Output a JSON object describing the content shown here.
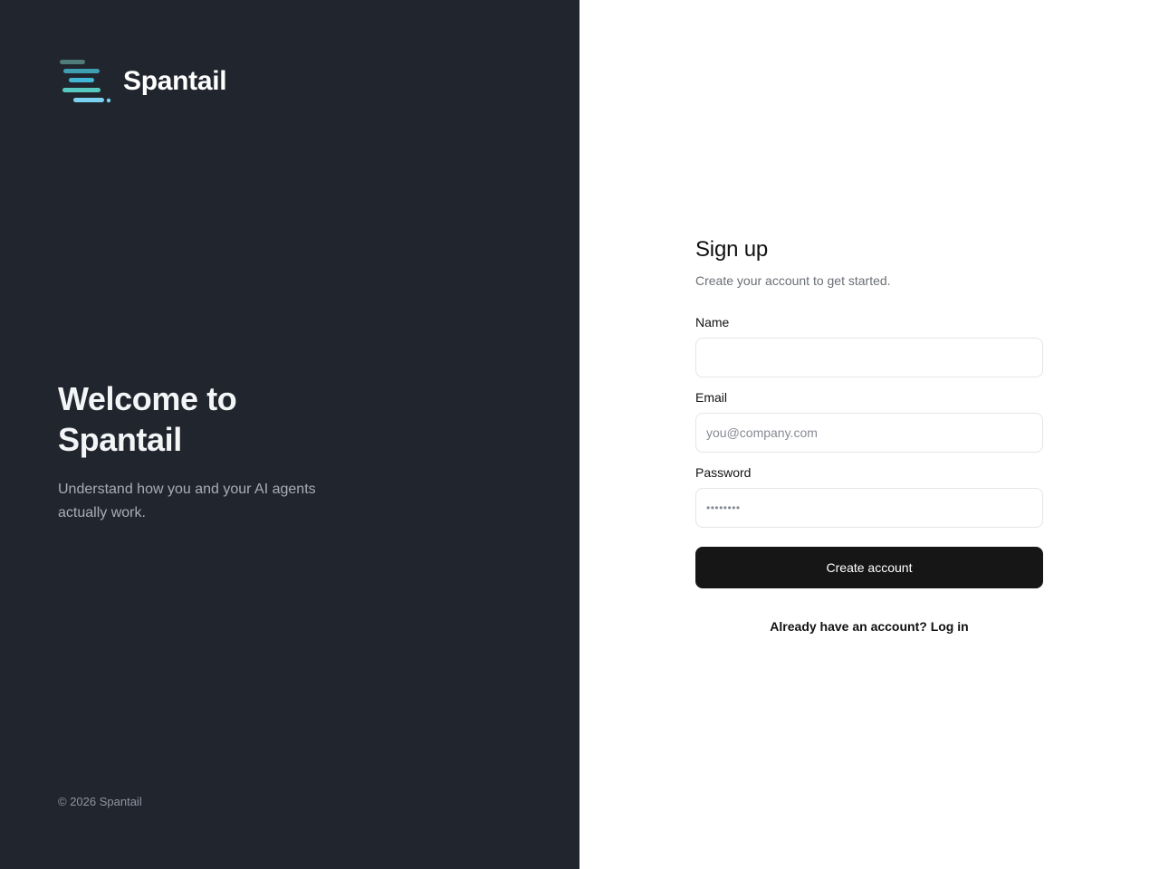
{
  "brand": {
    "name": "Spantail",
    "logo_icon": "spantail-logo-icon",
    "logo_colors": [
      "#4f7c7a",
      "#3f9fb2",
      "#43b8d6",
      "#58c9c0",
      "#7ad1f0"
    ]
  },
  "hero": {
    "title_line1": "Welcome to",
    "title_line2": "Spantail",
    "subtitle_line1": "Understand how you and your AI agents",
    "subtitle_line2": "actually work."
  },
  "footer": {
    "copyright": "© 2026 Spantail"
  },
  "form": {
    "title": "Sign up",
    "subtitle": "Create your account to get started.",
    "name": {
      "label": "Name",
      "value": "",
      "placeholder": ""
    },
    "email": {
      "label": "Email",
      "value": "",
      "placeholder": "you@company.com"
    },
    "password": {
      "label": "Password",
      "value": "",
      "placeholder": "••••••••"
    },
    "submit_label": "Create account",
    "login_prompt": "Already have an account?",
    "login_link": "Log in"
  },
  "colors": {
    "left_panel_bg": "#21262e",
    "button_bg": "#161616",
    "input_border": "#e3e5e8"
  }
}
